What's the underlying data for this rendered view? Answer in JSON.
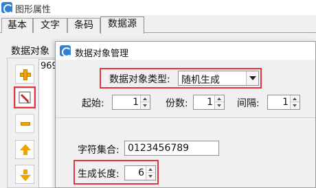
{
  "window": {
    "title": "图形属性"
  },
  "tabs": [
    {
      "label": "基本"
    },
    {
      "label": "文字"
    },
    {
      "label": "条码"
    },
    {
      "label": "数据源"
    }
  ],
  "left_panel": {
    "group_label": "数据对象",
    "list_items": [
      "969"
    ],
    "buttons": [
      {
        "name": "add-button",
        "icon": "plus-icon"
      },
      {
        "name": "edit-button",
        "icon": "edit-pencil-icon"
      },
      {
        "name": "delete-button",
        "icon": "minus-icon"
      },
      {
        "name": "move-up-button",
        "icon": "arrow-up-icon"
      },
      {
        "name": "move-down-button",
        "icon": "arrow-down-icon"
      }
    ]
  },
  "dialog": {
    "title": "数据对象管理",
    "type_label": "数据对象类型:",
    "type_value": "随机生成",
    "start_label": "起始:",
    "start_value": "1",
    "copies_label": "份数:",
    "copies_value": "1",
    "interval_label": "间隔:",
    "interval_value": "1",
    "charset_label": "字符集合:",
    "charset_value": "0123456789",
    "length_label": "生成长度:",
    "length_value": "6"
  },
  "colors": {
    "highlight_red": "#e8323c",
    "accent_orange": "#f0a400",
    "icon_blue": "#2f7fd6"
  }
}
